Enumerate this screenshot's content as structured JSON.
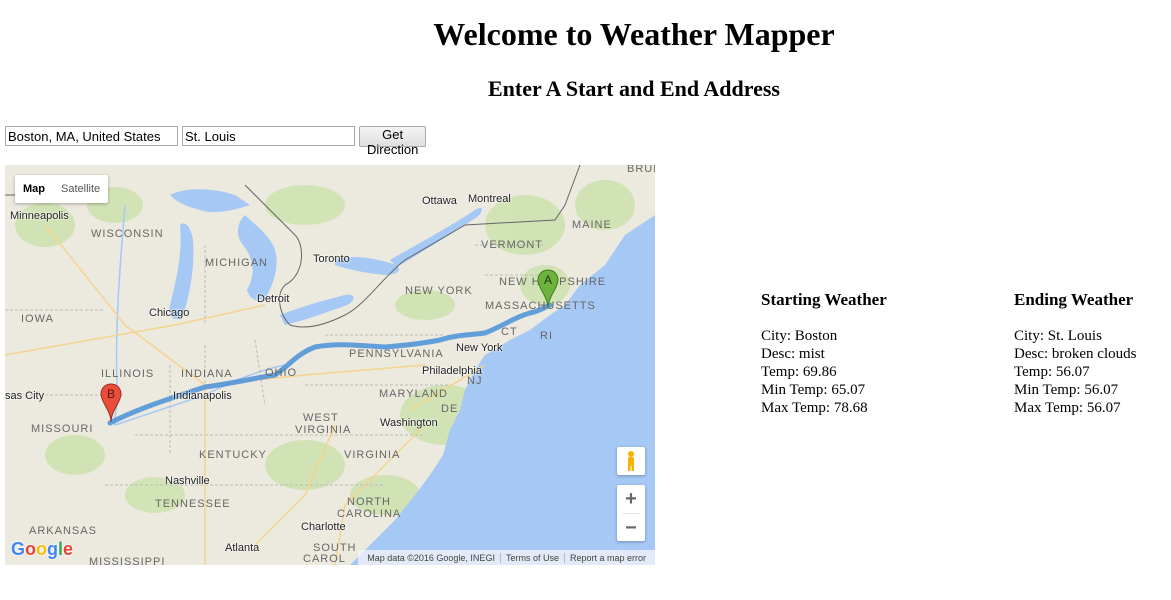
{
  "page": {
    "title": "Welcome to Weather Mapper",
    "subtitle": "Enter A Start and End Address"
  },
  "form": {
    "start_value": "Boston, MA, United States",
    "end_value": "St. Louis",
    "submit_label": "Get Direction"
  },
  "map": {
    "map_type_options": [
      "Map",
      "Satellite"
    ],
    "active_map_type": "Map",
    "marker_a_label": "A",
    "marker_b_label": "B",
    "marker_a_color": "#6fb33f",
    "marker_b_color": "#e94e3c",
    "route_color": "#4a90d9",
    "zoom_in_label": "+",
    "zoom_out_label": "−",
    "logo_text": "Google",
    "footer": {
      "attribution": "Map data ©2016 Google, INEGI",
      "terms": "Terms of Use",
      "report": "Report a map error"
    },
    "labels": {
      "brun": "BRUN",
      "minneapolis": "Minneapolis",
      "wisconsin": "WISCONSIN",
      "michigan": "MICHIGAN",
      "ottawa": "Ottawa",
      "montreal": "Montreal",
      "maine": "MAINE",
      "vermont": "VERMONT",
      "new_hampshire": "NEW HAMPSHIRE",
      "toronto": "Toronto",
      "detroit": "Detroit",
      "new_york_state": "NEW YORK",
      "massachusetts": "MASSACHUSETTS",
      "ct": "CT",
      "ri": "RI",
      "iowa": "IOWA",
      "chicago": "Chicago",
      "pennsylvania": "PENNSYLVANIA",
      "new_york_city": "New York",
      "illinois": "ILLINOIS",
      "indiana": "INDIANA",
      "ohio": "OHIO",
      "philadelphia": "Philadelphia",
      "nj": "NJ",
      "kansas_city": "sas City",
      "indianapolis": "Indianapolis",
      "maryland": "MARYLAND",
      "de": "DE",
      "missouri": "MISSOURI",
      "west_virginia_1": "WEST",
      "west_virginia_2": "VIRGINIA",
      "washington": "Washington",
      "kentucky": "KENTUCKY",
      "virginia": "VIRGINIA",
      "nashville": "Nashville",
      "tennessee": "TENNESSEE",
      "north_carolina_1": "NORTH",
      "north_carolina_2": "CAROLINA",
      "arkansas": "ARKANSAS",
      "charlotte": "Charlotte",
      "atlanta": "Atlanta",
      "south_carolina_1": "SOUTH",
      "south_carolina_2": "CAROL",
      "mississippi": "MISSISSIPPI"
    }
  },
  "starting_weather": {
    "heading": "Starting Weather",
    "city": "City: Boston",
    "desc": "Desc: mist",
    "temp": "Temp: 69.86",
    "min_temp": "Min Temp: 65.07",
    "max_temp": "Max Temp: 78.68"
  },
  "ending_weather": {
    "heading": "Ending Weather",
    "city": "City: St. Louis",
    "desc": "Desc: broken clouds",
    "temp": "Temp: 56.07",
    "min_temp": "Min Temp: 56.07",
    "max_temp": "Max Temp: 56.07"
  }
}
